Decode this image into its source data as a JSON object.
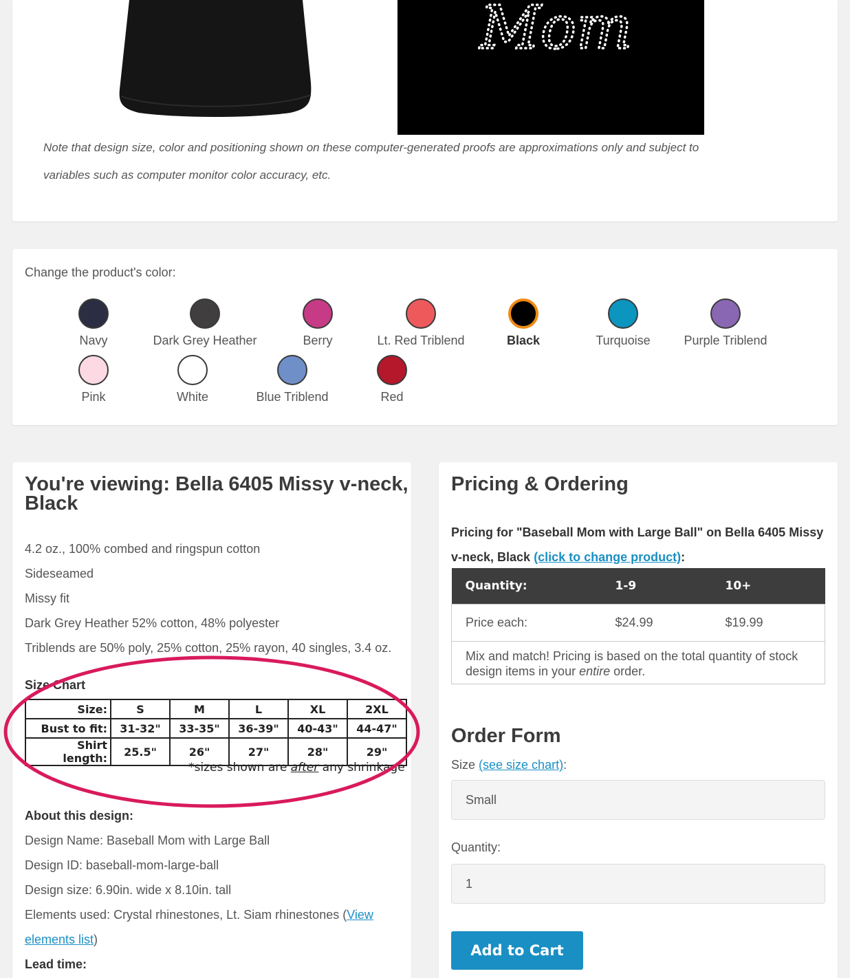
{
  "proof": {
    "design_script_text": "Mom",
    "note_line1": "Note that design size, color and positioning shown on these computer-generated proofs are approximations only and subject to",
    "note_line2": "variables such as computer monitor color accuracy, etc."
  },
  "colors": {
    "heading": "Change the product's color:",
    "items": [
      {
        "label": "Navy",
        "hex": "#2b2d42",
        "selected": false
      },
      {
        "label": "Dark Grey Heather",
        "hex": "#403e3e",
        "selected": false
      },
      {
        "label": "Berry",
        "hex": "#c73a86",
        "selected": false
      },
      {
        "label": "Lt. Red Triblend",
        "hex": "#ee5a5c",
        "selected": false
      },
      {
        "label": "Black",
        "hex": "#000000",
        "selected": true
      },
      {
        "label": "Turquoise",
        "hex": "#0b95bf",
        "selected": false
      },
      {
        "label": "Purple Triblend",
        "hex": "#8a67b3",
        "selected": false
      },
      {
        "label": "Pink",
        "hex": "#fcd9e3",
        "selected": false
      },
      {
        "label": "White",
        "hex": "#ffffff",
        "selected": false
      },
      {
        "label": "Blue Triblend",
        "hex": "#6f8fc9",
        "selected": false
      },
      {
        "label": "Red",
        "hex": "#b5172b",
        "selected": false
      }
    ],
    "selected_ring": "#f08a12"
  },
  "product": {
    "title_line1": "You're viewing: Bella 6405 Missy v-neck,",
    "title_line2": "Black",
    "features": [
      "4.2 oz., 100% combed and ringspun cotton",
      "Sideseamed",
      "Missy fit",
      "Dark Grey Heather 52% cotton, 48% polyester",
      "Triblends are 50% poly, 25% cotton, 25% rayon, 40 singles, 3.4 oz."
    ],
    "size_chart_heading": "Size Chart",
    "size_chart": {
      "rows": [
        {
          "label": "Size:",
          "values": [
            "S",
            "M",
            "L",
            "XL",
            "2XL"
          ]
        },
        {
          "label": "Bust to fit:",
          "values": [
            "31-32\"",
            "33-35\"",
            "36-39\"",
            "40-43\"",
            "44-47\""
          ]
        },
        {
          "label": "Shirt length:",
          "values": [
            "25.5\"",
            "26\"",
            "27\"",
            "28\"",
            "29\""
          ]
        }
      ],
      "note_prefix": "*sizes shown are ",
      "note_emph": "after",
      "note_suffix": " any shrinkage"
    },
    "about_heading": "About this design:",
    "design_name": "Design Name: Baseball Mom with Large Ball",
    "design_id": "Design ID: baseball-mom-large-ball",
    "design_size": "Design size: 6.90in. wide x 8.10in. tall",
    "elements_prefix": "Elements used: Crystal rhinestones, Lt. Siam rhinestones (",
    "elements_link_part1": "View",
    "elements_link_part2": "elements list",
    "elements_suffix": ")",
    "lead_time_heading": "Lead time:"
  },
  "pricing": {
    "title": "Pricing & Ordering",
    "pricing_for": "Pricing for \"Baseball Mom with Large Ball\" on Bella 6405 Missy v-neck, Black ",
    "change_product_link": "(click to change product)",
    "pricing_for_suffix": ":",
    "table": {
      "headers": [
        "Quantity:",
        "1-9",
        "10+"
      ],
      "price_row_label": "Price each:",
      "prices": [
        "$24.99",
        "$19.99"
      ],
      "note_prefix": "Mix and match! Pricing is based on the total quantity of stock design items in your ",
      "note_emph": "entire",
      "note_suffix": " order."
    }
  },
  "order_form": {
    "title": "Order Form",
    "size_label": "Size ",
    "size_chart_link": "(see size chart)",
    "size_label_suffix": ":",
    "size_value": "Small",
    "quantity_label": "Quantity:",
    "quantity_value": "1",
    "add_to_cart": "Add to Cart"
  }
}
